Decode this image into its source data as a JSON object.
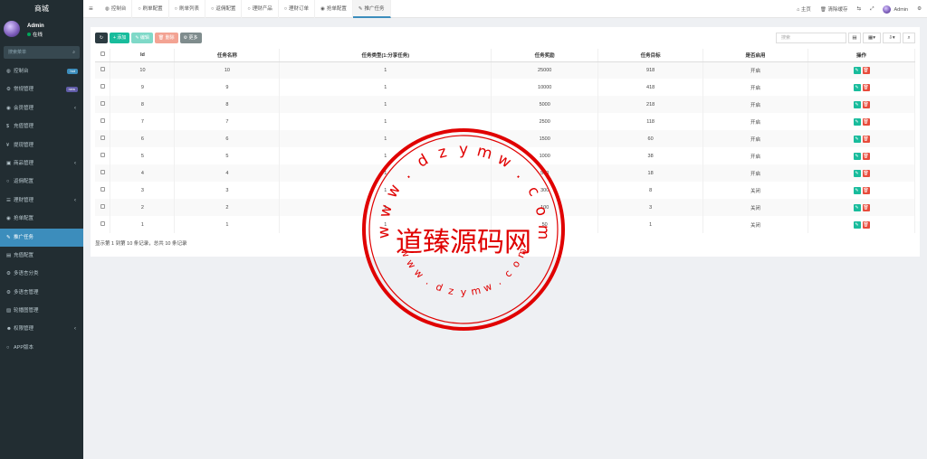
{
  "sidebar": {
    "logo": "商城",
    "user": {
      "name": "Admin",
      "status": "在线"
    },
    "search_placeholder": "搜索菜单",
    "items": [
      {
        "icon": "dashboard-icon",
        "glyph": "◍",
        "label": "控制台",
        "badge": "hot",
        "badge_color": "#3c8dbc"
      },
      {
        "icon": "settings-icon",
        "glyph": "⚙",
        "label": "常规管理",
        "badge": "new",
        "badge_color": "#605ca8"
      },
      {
        "icon": "user-icon",
        "glyph": "◉",
        "label": "会员管理",
        "caret": "‹"
      },
      {
        "icon": "recharge-icon",
        "glyph": "$",
        "label": "充值管理"
      },
      {
        "icon": "withdraw-icon",
        "glyph": "¥",
        "label": "提现管理"
      },
      {
        "icon": "shop-icon",
        "glyph": "▣",
        "label": "商品管理",
        "caret": "‹"
      },
      {
        "icon": "circle-icon",
        "glyph": "○",
        "label": "返佣配置"
      },
      {
        "icon": "finance-icon",
        "glyph": "☰",
        "label": "理财管理",
        "caret": "‹"
      },
      {
        "icon": "order-icon",
        "glyph": "◉",
        "label": "抢单配置"
      },
      {
        "icon": "link-icon",
        "glyph": "✎",
        "label": "推广任务",
        "active": true
      },
      {
        "icon": "recharge-config-icon",
        "glyph": "▤",
        "label": "充值配置"
      },
      {
        "icon": "share-icon",
        "glyph": "⚙",
        "label": "多语言分类"
      },
      {
        "icon": "language-icon",
        "glyph": "⚙",
        "label": "多语言管理"
      },
      {
        "icon": "image-icon",
        "glyph": "▨",
        "label": "轮播图管理"
      },
      {
        "icon": "group-icon",
        "glyph": "☻",
        "label": "权限管理",
        "caret": "‹"
      },
      {
        "icon": "circle-icon",
        "glyph": "○",
        "label": "APP版本"
      }
    ]
  },
  "topbar": {
    "toggle": "≡",
    "tabs": [
      {
        "icon": "dashboard-icon",
        "glyph": "◍",
        "label": "控制台"
      },
      {
        "icon": "circle-icon",
        "glyph": "○",
        "label": "刷单配置"
      },
      {
        "icon": "circle-icon",
        "glyph": "○",
        "label": "刷单列表"
      },
      {
        "icon": "circle-icon",
        "glyph": "○",
        "label": "返佣配置"
      },
      {
        "icon": "circle-icon",
        "glyph": "○",
        "label": "理财产品"
      },
      {
        "icon": "circle-icon",
        "glyph": "○",
        "label": "理财订单"
      },
      {
        "icon": "order-icon",
        "glyph": "◉",
        "label": "抢单配置"
      },
      {
        "icon": "link-icon",
        "glyph": "✎",
        "label": "推广任务",
        "active": true
      }
    ],
    "right": {
      "home": "主页",
      "clear_cache": "清除缓存",
      "user": "Admin"
    }
  },
  "toolbar": {
    "refresh": "↻",
    "add": "+ 添加",
    "edit": "✎ 编辑",
    "delete": "🗑 删除",
    "more": "⚙ 更多",
    "search_placeholder": "搜索",
    "tool_columns": "▤",
    "tool_toggle": "▦▾",
    "tool_export": "⇩▾",
    "tool_search": "⌕"
  },
  "table": {
    "headers": [
      "",
      "Id",
      "任务名称",
      "任务类型(1:分享任务)",
      "任务奖励",
      "任务目标",
      "是否启用",
      "操作"
    ],
    "rows": [
      {
        "id": "10",
        "name": "10",
        "type": "1",
        "reward": "25000",
        "target": "918",
        "enabled": "开启"
      },
      {
        "id": "9",
        "name": "9",
        "type": "1",
        "reward": "10000",
        "target": "418",
        "enabled": "开启"
      },
      {
        "id": "8",
        "name": "8",
        "type": "1",
        "reward": "5000",
        "target": "218",
        "enabled": "开启"
      },
      {
        "id": "7",
        "name": "7",
        "type": "1",
        "reward": "2500",
        "target": "118",
        "enabled": "开启"
      },
      {
        "id": "6",
        "name": "6",
        "type": "1",
        "reward": "1500",
        "target": "60",
        "enabled": "开启"
      },
      {
        "id": "5",
        "name": "5",
        "type": "1",
        "reward": "1000",
        "target": "38",
        "enabled": "开启"
      },
      {
        "id": "4",
        "name": "4",
        "type": "1",
        "reward": "500",
        "target": "18",
        "enabled": "开启"
      },
      {
        "id": "3",
        "name": "3",
        "type": "1",
        "reward": "300",
        "target": "8",
        "enabled": "关闭"
      },
      {
        "id": "2",
        "name": "2",
        "type": "1",
        "reward": "100",
        "target": "3",
        "enabled": "关闭"
      },
      {
        "id": "1",
        "name": "1",
        "type": "1",
        "reward": "50",
        "target": "1",
        "enabled": "关闭"
      }
    ],
    "footer": "显示第 1 到第 10 条记录，总共 10 条记录"
  },
  "watermark": {
    "center_text": "道臻源码网",
    "ring_text": "www.dzymw.com",
    "color": "#e00000"
  }
}
